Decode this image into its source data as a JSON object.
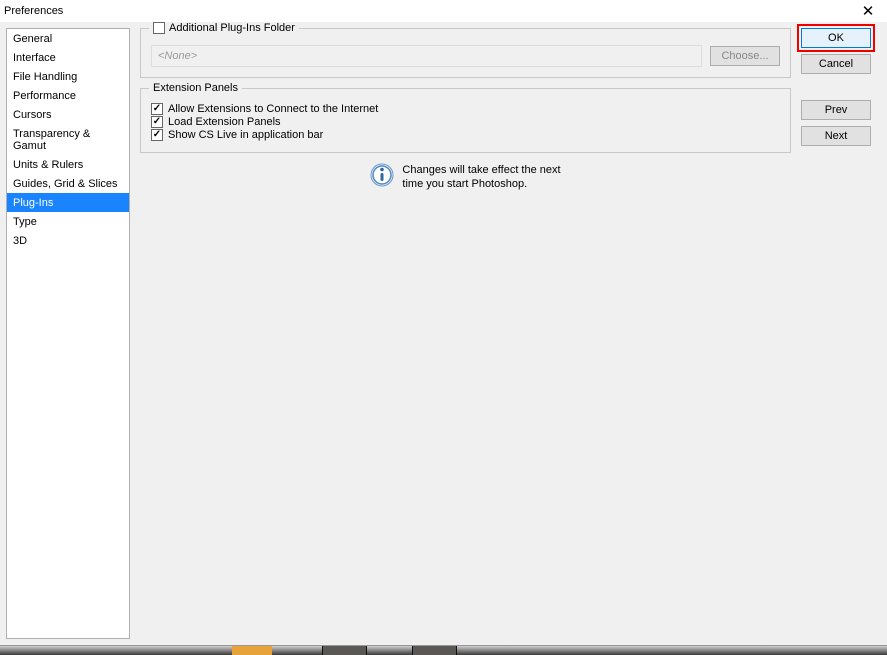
{
  "window": {
    "title": "Preferences"
  },
  "sidebar": {
    "items": [
      {
        "label": "General"
      },
      {
        "label": "Interface"
      },
      {
        "label": "File Handling"
      },
      {
        "label": "Performance"
      },
      {
        "label": "Cursors"
      },
      {
        "label": "Transparency & Gamut"
      },
      {
        "label": "Units & Rulers"
      },
      {
        "label": "Guides, Grid & Slices"
      },
      {
        "label": "Plug-Ins"
      },
      {
        "label": "Type"
      },
      {
        "label": "3D"
      }
    ],
    "active": "Plug-Ins"
  },
  "groups": {
    "additional": {
      "checkbox_label": "Additional Plug-Ins Folder",
      "checked": false,
      "path_value": "<None>",
      "choose_label": "Choose..."
    },
    "extension": {
      "legend": "Extension Panels",
      "options": [
        {
          "label": "Allow Extensions to Connect to the Internet",
          "checked": true
        },
        {
          "label": "Load Extension Panels",
          "checked": true
        },
        {
          "label": "Show CS Live in application bar",
          "checked": true
        }
      ]
    }
  },
  "info": {
    "line1": "Changes will take effect the next",
    "line2": "time you start Photoshop."
  },
  "buttons": {
    "ok": "OK",
    "cancel": "Cancel",
    "prev": "Prev",
    "next": "Next"
  }
}
